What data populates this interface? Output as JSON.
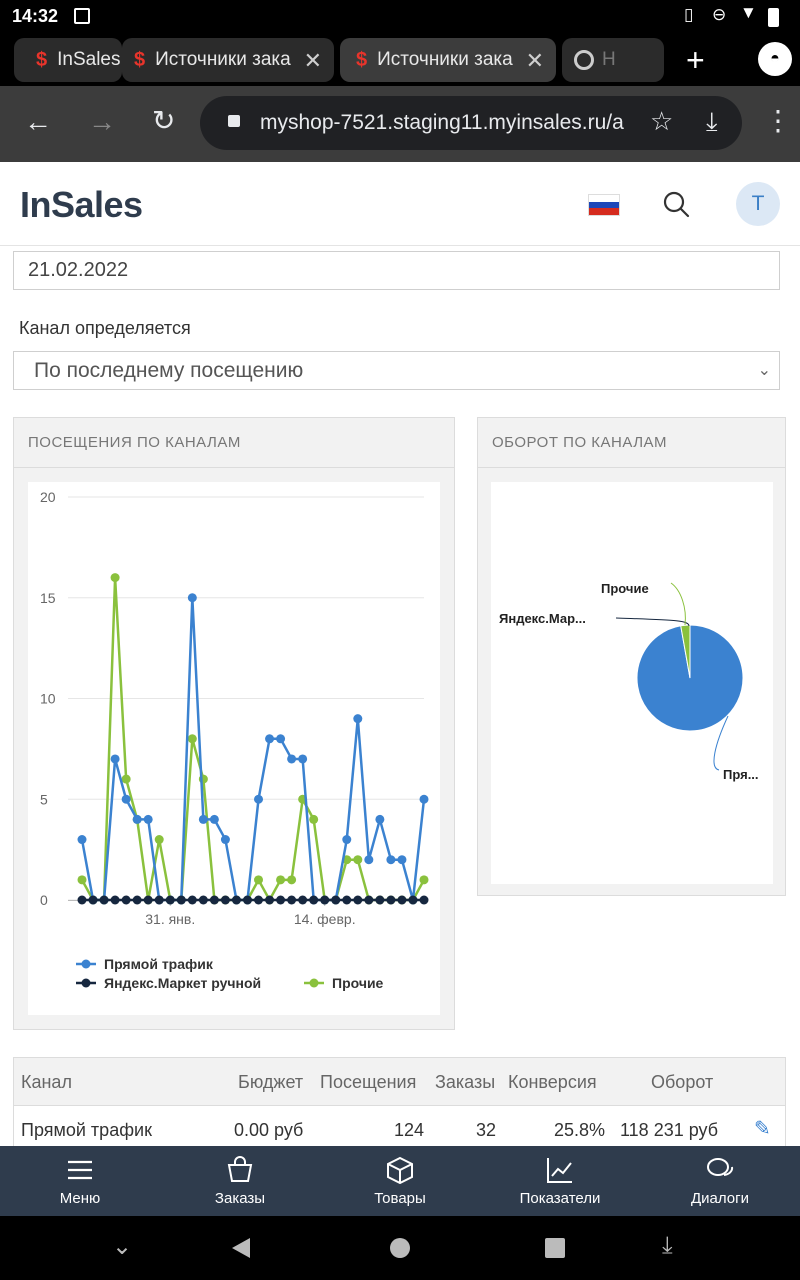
{
  "status": {
    "time": "14:32"
  },
  "browser": {
    "tabs": [
      {
        "title": "InSales"
      },
      {
        "title": "Источники зака"
      },
      {
        "title": "Источники зака"
      },
      {
        "title": "Н"
      }
    ],
    "url": "myshop-7521.staging11.myinsales.ru/a"
  },
  "header": {
    "logo": "InSales",
    "avatar_letter": "T"
  },
  "filters": {
    "date_value": "21.02.2022",
    "channel_label": "Канал определяется",
    "channel_value": "По последнему посещению"
  },
  "visits_panel": {
    "title": "ПОСЕЩЕНИЯ ПО КАНАЛАМ"
  },
  "revenue_panel": {
    "title": "ОБОРОТ ПО КАНАЛАМ"
  },
  "chart_data": [
    {
      "type": "line",
      "title": "ПОСЕЩЕНИЯ ПО КАНАЛАМ",
      "ylim": [
        0,
        20
      ],
      "y_ticks": [
        "0",
        "5",
        "10",
        "15",
        "20"
      ],
      "x_tick_labels": [
        "31. янв.",
        "14. февр."
      ],
      "x_tick_indices": [
        8,
        22
      ],
      "series": [
        {
          "name": "Прямой трафик",
          "color": "#3b82d0",
          "values": [
            3,
            0,
            0,
            7,
            5,
            4,
            4,
            0,
            0,
            0,
            15,
            4,
            4,
            3,
            0,
            0,
            5,
            8,
            8,
            7,
            7,
            0,
            0,
            0,
            3,
            9,
            2,
            4,
            2,
            2,
            0,
            5
          ]
        },
        {
          "name": "Яндекс.Маркет ручной",
          "color": "#16273f",
          "values": [
            0,
            0,
            0,
            0,
            0,
            0,
            0,
            0,
            0,
            0,
            0,
            0,
            0,
            0,
            0,
            0,
            0,
            0,
            0,
            0,
            0,
            0,
            0,
            0,
            0,
            0,
            0,
            0,
            0,
            0,
            0,
            0
          ]
        },
        {
          "name": "Прочие",
          "color": "#8ac13d",
          "values": [
            1,
            0,
            0,
            16,
            6,
            4,
            0,
            3,
            0,
            0,
            8,
            6,
            0,
            0,
            0,
            0,
            1,
            0,
            1,
            1,
            5,
            4,
            0,
            0,
            2,
            2,
            0,
            0,
            0,
            0,
            0,
            1
          ]
        }
      ]
    },
    {
      "type": "pie",
      "title": "ОБОРОТ ПО КАНАЛАМ",
      "slices": [
        {
          "name": "Прямой трафик",
          "label": "Пря...",
          "value": 118231,
          "color": "#3b82d0"
        },
        {
          "name": "Яндекс.Маркет ручной",
          "label": "Яндекс.Мар...",
          "value": 0,
          "color": "#16273f"
        },
        {
          "name": "Прочие",
          "label": "Прочие",
          "value": 3400,
          "color": "#8ac13d"
        }
      ]
    }
  ],
  "table": {
    "headers": [
      "Канал",
      "Бюджет",
      "Посещения",
      "Заказы",
      "Конверсия",
      "Оборот"
    ],
    "rows": [
      [
        "Прямой трафик",
        "0.00 руб",
        "124",
        "32",
        "25.8%",
        "118 231 руб"
      ]
    ]
  },
  "bottom_nav": [
    {
      "label": "Меню",
      "icon": "menu-icon"
    },
    {
      "label": "Заказы",
      "icon": "bag-icon"
    },
    {
      "label": "Товары",
      "icon": "box-icon"
    },
    {
      "label": "Показатели",
      "icon": "chart-icon"
    },
    {
      "label": "Диалоги",
      "icon": "chat-icon"
    }
  ]
}
